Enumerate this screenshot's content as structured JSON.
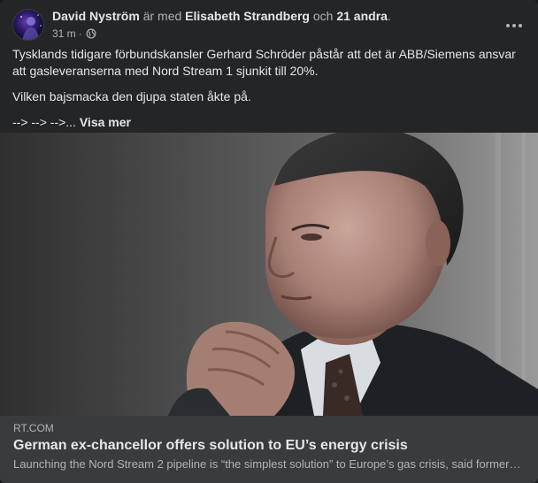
{
  "post": {
    "author": "David Nyström",
    "with_text": "är med",
    "tagged_person": "Elisabeth Strandberg",
    "and_text": "och",
    "others": "21 andra",
    "period": ".",
    "timestamp": "31 m",
    "separator": "·",
    "privacy_icon": "globe-icon",
    "more_icon": "more-horizontal-icon",
    "paragraph1": "Tysklands tidigare förbundskansler Gerhard Schröder påstår att det är ABB/Siemens ansvar att gasleveranserna med Nord Stream 1 sjunkit till 20%.",
    "paragraph2": "Vilken bajsmacka den djupa staten åkte på.",
    "paragraph3_prefix": "--> --> -->...",
    "see_more": "Visa mer"
  },
  "link_preview": {
    "domain": "RT.COM",
    "title": "German ex-chancellor offers solution to EU’s energy crisis",
    "description": "Launching the Nord Stream 2 pipeline is “the simplest solution” to Europe’s gas crisis, said former German Chancellor Gerhard Schröder"
  },
  "colors": {
    "card_bg": "#242526",
    "text_primary": "#e4e6eb",
    "text_secondary": "#b0b3b8",
    "link_card_bg": "#3a3b3c"
  }
}
